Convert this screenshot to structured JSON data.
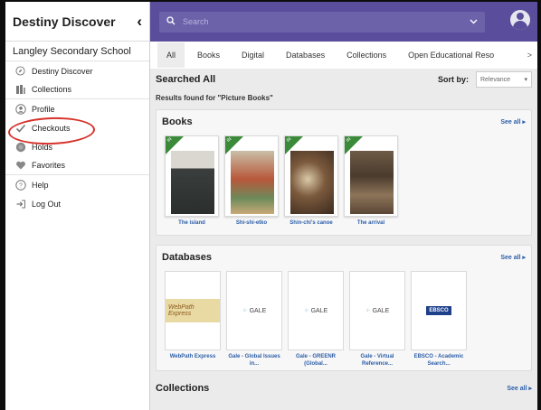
{
  "sidebar": {
    "title": "Destiny Discover",
    "back_icon": "chevron-left-icon",
    "school": "Langley Secondary School",
    "items": [
      {
        "label": "Destiny Discover",
        "icon": "compass-icon"
      },
      {
        "label": "Collections",
        "icon": "books-icon"
      },
      {
        "label": "Profile",
        "icon": "user-icon"
      },
      {
        "label": "Checkouts",
        "icon": "check-icon"
      },
      {
        "label": "Holds",
        "icon": "holds-icon"
      },
      {
        "label": "Favorites",
        "icon": "heart-icon"
      },
      {
        "label": "Help",
        "icon": "question-icon"
      },
      {
        "label": "Log Out",
        "icon": "logout-icon"
      }
    ]
  },
  "topbar": {
    "search_placeholder": "Search",
    "search_icon": "search-icon",
    "dropdown_icon": "chevron-down-icon"
  },
  "tabs": [
    {
      "label": "All"
    },
    {
      "label": "Books"
    },
    {
      "label": "Digital"
    },
    {
      "label": "Databases"
    },
    {
      "label": "Collections"
    },
    {
      "label": "Open Educational Reso"
    }
  ],
  "tabs_more": ">",
  "results": {
    "heading": "Searched All",
    "sort_label": "Sort by:",
    "sort_value": "Relevance",
    "found_text": "Results found for \"Picture Books\""
  },
  "books": {
    "title": "Books",
    "see_all": "See all ▸",
    "items": [
      {
        "title": "The island",
        "ribbon": "IN"
      },
      {
        "title": "Shi-shi-etko",
        "ribbon": "IN"
      },
      {
        "title": "Shin-chi's canoe",
        "ribbon": "IN"
      },
      {
        "title": "The arrival",
        "ribbon": "IN"
      }
    ]
  },
  "databases": {
    "title": "Databases",
    "see_all": "See all ▸",
    "items": [
      {
        "label": "WebPath Express",
        "logo": "WebPath Express"
      },
      {
        "label": "Gale - Global Issues in...",
        "logo": "GALE"
      },
      {
        "label": "Gale - GREENR (Global...",
        "logo": "GALE"
      },
      {
        "label": "Gale - Virtual Reference...",
        "logo": "GALE"
      },
      {
        "label": "EBSCO - Academic Search...",
        "logo": "EBSCO"
      }
    ]
  },
  "collections_row": {
    "title": "Collections",
    "see_all": "See all ▸"
  },
  "colors": {
    "topbar": "#5a4d9b",
    "accent_link": "#2c5ea8",
    "ribbon": "#3a8a3a",
    "annotation_circle": "#d6322a"
  }
}
